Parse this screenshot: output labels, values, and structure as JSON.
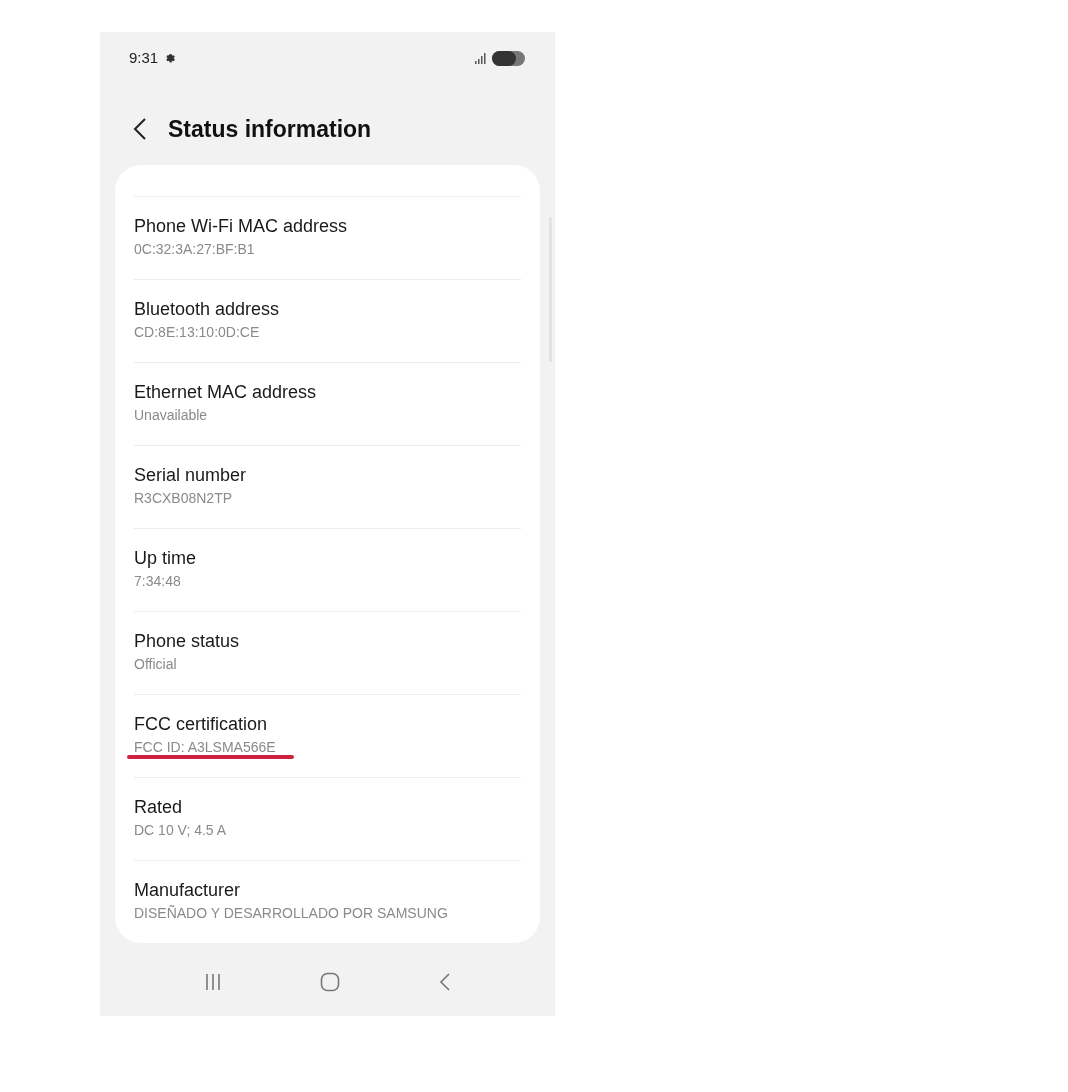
{
  "status_bar": {
    "time": "9:31"
  },
  "header": {
    "title": "Status information"
  },
  "items": [
    {
      "title": "Phone Wi-Fi MAC address",
      "value": "0C:32:3A:27:BF:B1",
      "underlined": false
    },
    {
      "title": "Bluetooth address",
      "value": "CD:8E:13:10:0D:CE",
      "underlined": false
    },
    {
      "title": "Ethernet MAC address",
      "value": "Unavailable",
      "underlined": false
    },
    {
      "title": "Serial number",
      "value": "R3CXB08N2TP",
      "underlined": false
    },
    {
      "title": "Up time",
      "value": "7:34:48",
      "underlined": false
    },
    {
      "title": "Phone status",
      "value": "Official",
      "underlined": false
    },
    {
      "title": "FCC certification",
      "value": "FCC ID: A3LSMA566E",
      "underlined": true
    },
    {
      "title": "Rated",
      "value": "DC 10 V; 4.5 A",
      "underlined": false
    },
    {
      "title": "Manufacturer",
      "value": "DISEÑADO Y DESARROLLADO POR SAMSUNG",
      "underlined": false
    }
  ]
}
